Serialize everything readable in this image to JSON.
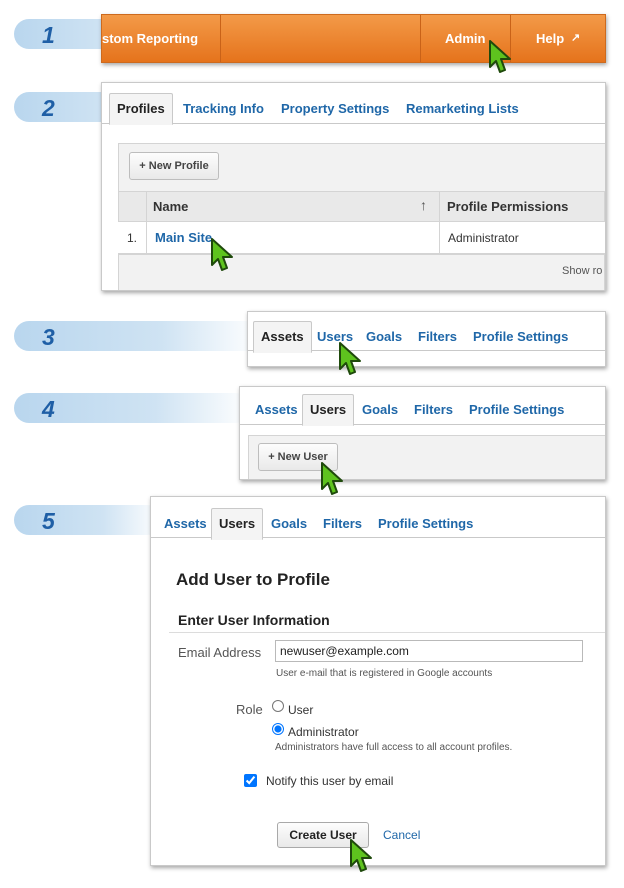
{
  "steps": [
    "1",
    "2",
    "3",
    "4",
    "5"
  ],
  "step1": {
    "nav_reporting": "stom Reporting",
    "nav_admin": "Admin",
    "nav_help": "Help"
  },
  "step2": {
    "tabs": [
      "Profiles",
      "Tracking Info",
      "Property Settings",
      "Remarketing Lists"
    ],
    "new_profile": "+ New Profile",
    "columns": {
      "name": "Name",
      "permissions": "Profile Permissions"
    },
    "row": {
      "index": "1.",
      "name": "Main Site",
      "permission": "Administrator"
    },
    "show_rows": "Show ro"
  },
  "step3": {
    "tabs": [
      "Assets",
      "Users",
      "Goals",
      "Filters",
      "Profile Settings"
    ]
  },
  "step4": {
    "tabs": [
      "Assets",
      "Users",
      "Goals",
      "Filters",
      "Profile Settings"
    ],
    "new_user": "+ New User"
  },
  "step5": {
    "tabs": [
      "Assets",
      "Users",
      "Goals",
      "Filters",
      "Profile Settings"
    ],
    "title": "Add User to Profile",
    "section": "Enter User Information",
    "email_label": "Email Address",
    "email_value": "newuser@example.com",
    "email_hint": "User e-mail that is registered in Google accounts",
    "role_label": "Role",
    "role_user": "User",
    "role_admin": "Administrator",
    "role_hint": "Administrators have full access to all account profiles.",
    "notify": "Notify this user by email",
    "create": "Create User",
    "cancel": "Cancel"
  },
  "colors": {
    "accent_orange": "#e8792a",
    "link_blue": "#1f67a8",
    "cursor_green": "#5ec31e",
    "step_blue": "#1f5fa6"
  }
}
